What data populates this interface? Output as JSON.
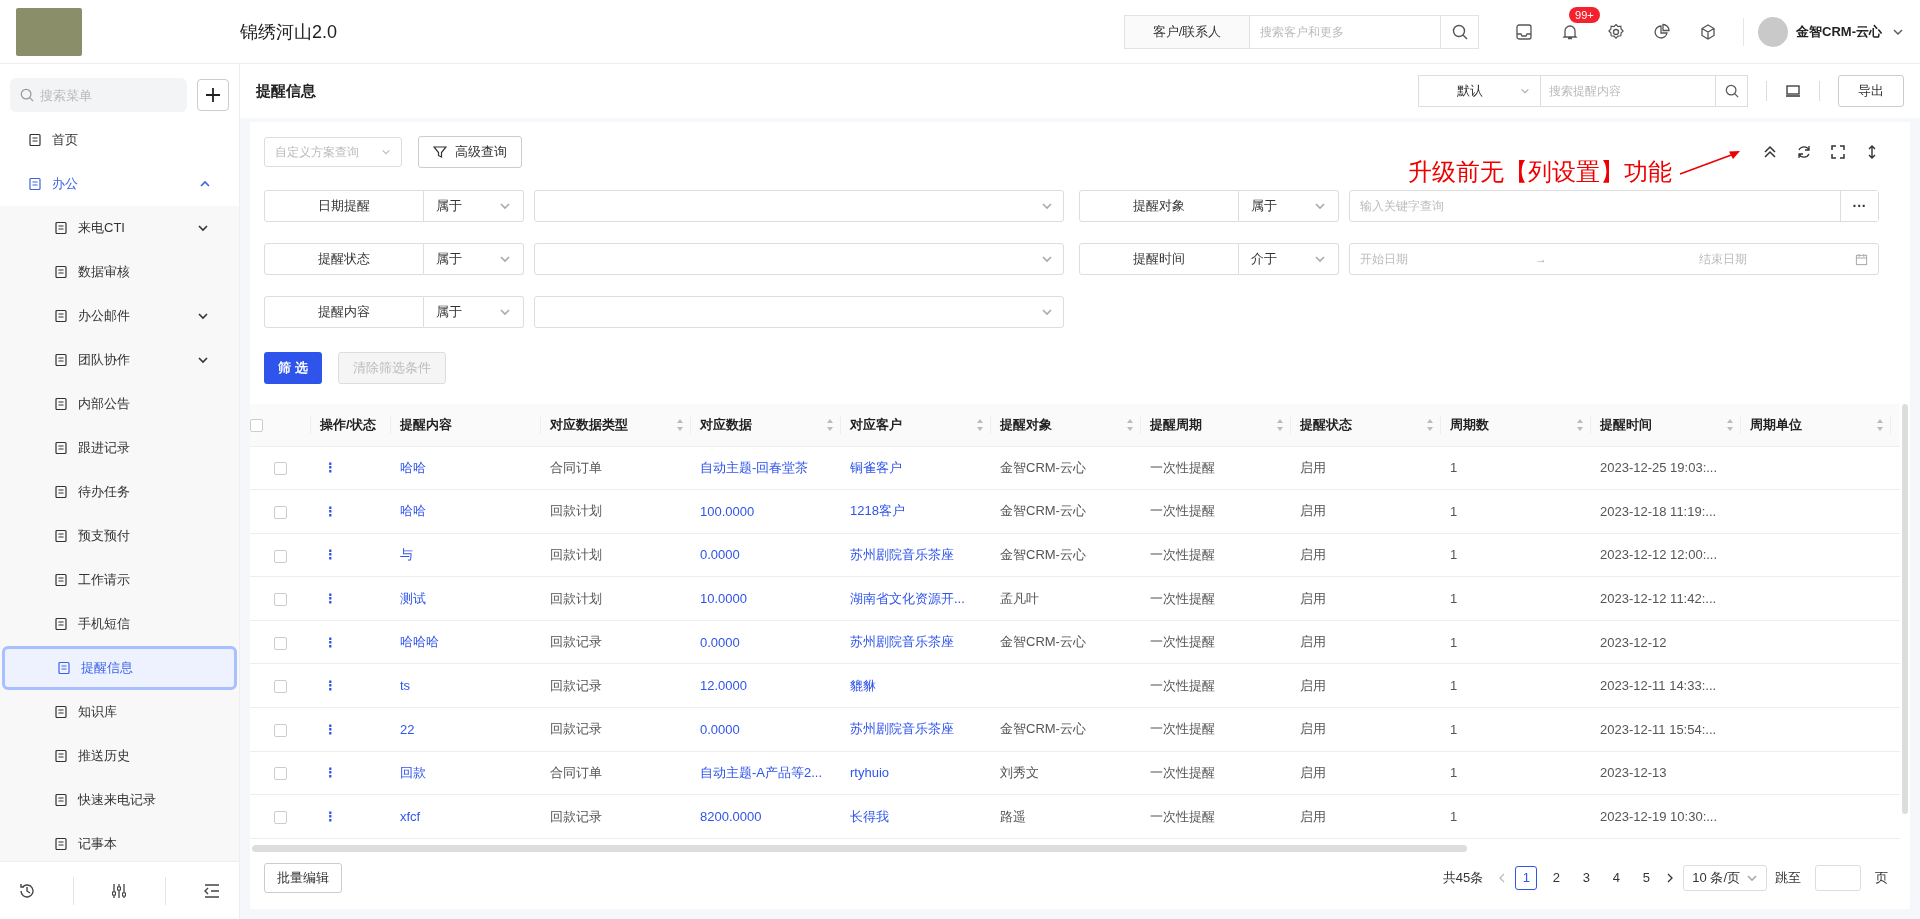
{
  "header": {
    "title": "锦绣河山2.0",
    "search": {
      "scope": "客户/联系人",
      "placeholder": "搜索客户和更多"
    },
    "badge": "99+",
    "user": "金智CRM-云心"
  },
  "sidebar": {
    "search": {
      "placeholder": "搜索菜单"
    },
    "items": [
      {
        "label": "首页",
        "selected": false
      },
      {
        "label": "办公",
        "selected": false,
        "expanded": true,
        "children": [
          {
            "label": "来电CTI",
            "selected": false,
            "expanded": false
          },
          {
            "label": "数据审核",
            "selected": false
          },
          {
            "label": "办公邮件",
            "selected": false,
            "expanded": false
          },
          {
            "label": "团队协作",
            "selected": false,
            "expanded": false
          },
          {
            "label": "内部公告",
            "selected": false
          },
          {
            "label": "跟进记录",
            "selected": false
          },
          {
            "label": "待办任务",
            "selected": false
          },
          {
            "label": "预支预付",
            "selected": false
          },
          {
            "label": "工作请示",
            "selected": false
          },
          {
            "label": "手机短信",
            "selected": false
          },
          {
            "label": "提醒信息",
            "selected": true
          },
          {
            "label": "知识库",
            "selected": false
          },
          {
            "label": "推送历史",
            "selected": false
          },
          {
            "label": "快速来电记录",
            "selected": false
          },
          {
            "label": "记事本",
            "selected": false
          }
        ]
      }
    ]
  },
  "page": {
    "title": "提醒信息",
    "view": "默认",
    "search": {
      "placeholder": "搜索提醒内容"
    },
    "export": "导出"
  },
  "filters": {
    "scheme": {
      "placeholder": "自定义方案查询"
    },
    "advanced": "高级查询",
    "fields": [
      {
        "kind": "select",
        "label": "日期提醒",
        "operator": "属于"
      },
      {
        "kind": "keyword",
        "label": "提醒对象",
        "operator": "属于",
        "placeholder": "输入关键字查询",
        "more": "···"
      },
      {
        "kind": "select",
        "label": "提醒状态",
        "operator": "属于"
      },
      {
        "kind": "daterange",
        "label": "提醒时间",
        "operator": "介于",
        "start": "开始日期",
        "arrow": "→",
        "end": "结束日期"
      },
      {
        "kind": "select",
        "label": "提醒内容",
        "operator": "属于"
      }
    ],
    "apply": {
      "label": "筛 选",
      "disabled": false
    },
    "clear": {
      "label": "清除筛选条件",
      "disabled": true
    }
  },
  "annotation": "升级前无【列设置】功能",
  "table": {
    "all_checked": false,
    "columns": [
      {
        "label": "操作/状态",
        "sortable": false,
        "kind": "menu"
      },
      {
        "label": "提醒内容",
        "sortable": false,
        "kind": "link"
      },
      {
        "label": "对应数据类型",
        "sortable": true,
        "kind": "text"
      },
      {
        "label": "对应数据",
        "sortable": true,
        "kind": "link"
      },
      {
        "label": "对应客户",
        "sortable": true,
        "kind": "link"
      },
      {
        "label": "提醒对象",
        "sortable": true,
        "kind": "text"
      },
      {
        "label": "提醒周期",
        "sortable": true,
        "kind": "text"
      },
      {
        "label": "提醒状态",
        "sortable": true,
        "kind": "text"
      },
      {
        "label": "周期数",
        "sortable": true,
        "kind": "text"
      },
      {
        "label": "提醒时间",
        "sortable": true,
        "kind": "text"
      },
      {
        "label": "周期单位",
        "sortable": true,
        "kind": "text"
      }
    ],
    "rows": [
      {
        "checked": false,
        "cells": [
          "⋮",
          "哈哈",
          "合同订单",
          "自动主题-回春堂茶",
          "铜雀客户",
          "金智CRM-云心",
          "一次性提醒",
          "启用",
          "1",
          "2023-12-25 19:03:...",
          ""
        ]
      },
      {
        "checked": false,
        "cells": [
          "⋮",
          "哈哈",
          "回款计划",
          "100.0000",
          "1218客户",
          "金智CRM-云心",
          "一次性提醒",
          "启用",
          "1",
          "2023-12-18 11:19:...",
          ""
        ]
      },
      {
        "checked": false,
        "cells": [
          "⋮",
          "与",
          "回款计划",
          "0.0000",
          "苏州剧院音乐茶座",
          "金智CRM-云心",
          "一次性提醒",
          "启用",
          "1",
          "2023-12-12 12:00:...",
          ""
        ]
      },
      {
        "checked": false,
        "cells": [
          "⋮",
          "测试",
          "回款计划",
          "10.0000",
          "湖南省文化资源开...",
          "孟凡叶",
          "一次性提醒",
          "启用",
          "1",
          "2023-12-12 11:42:...",
          ""
        ]
      },
      {
        "checked": false,
        "cells": [
          "⋮",
          "哈哈哈",
          "回款记录",
          "0.0000",
          "苏州剧院音乐茶座",
          "金智CRM-云心",
          "一次性提醒",
          "启用",
          "1",
          "2023-12-12",
          ""
        ]
      },
      {
        "checked": false,
        "cells": [
          "⋮",
          "ts",
          "回款记录",
          "12.0000",
          "貔貅",
          "",
          "一次性提醒",
          "启用",
          "1",
          "2023-12-11 14:33:...",
          ""
        ]
      },
      {
        "checked": false,
        "cells": [
          "⋮",
          "22",
          "回款记录",
          "0.0000",
          "苏州剧院音乐茶座",
          "金智CRM-云心",
          "一次性提醒",
          "启用",
          "1",
          "2023-12-11 15:54:...",
          ""
        ]
      },
      {
        "checked": false,
        "cells": [
          "⋮",
          "回款",
          "合同订单",
          "自动主题-A产品等2...",
          "rtyhuio",
          "刘秀文",
          "一次性提醒",
          "启用",
          "1",
          "2023-12-13",
          ""
        ]
      },
      {
        "checked": false,
        "cells": [
          "⋮",
          "xfcf",
          "回款记录",
          "8200.0000",
          "长得我",
          "路遥",
          "一次性提醒",
          "启用",
          "1",
          "2023-12-19 10:30:...",
          ""
        ]
      }
    ]
  },
  "footer": {
    "batch_edit": "批量编辑",
    "total": "共45条",
    "pages": [
      {
        "label": "1",
        "selected": true
      },
      {
        "label": "2",
        "selected": false
      },
      {
        "label": "3",
        "selected": false
      },
      {
        "label": "4",
        "selected": false
      },
      {
        "label": "5",
        "selected": false
      }
    ],
    "page_size": "10 条/页",
    "jump_label": "跳至",
    "jump_suffix": "页"
  }
}
